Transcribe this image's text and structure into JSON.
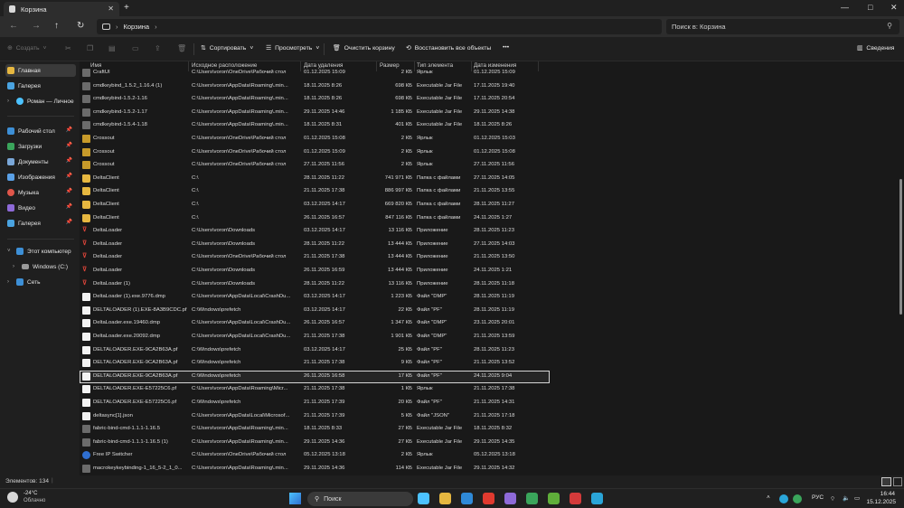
{
  "window": {
    "tab_title": "Корзина",
    "minimize": "—",
    "maximize": "□",
    "close": "✕",
    "tab_close": "✕",
    "new_tab": "+"
  },
  "address": {
    "path": "Корзина",
    "search_placeholder": "Поиск в: Корзина"
  },
  "toolbar": {
    "create": "Создать",
    "sort": "Сортировать",
    "view": "Просмотреть",
    "empty_bin": "Очистить корзину",
    "restore_all": "Восстановить все объекты",
    "more": "•••",
    "details": "Сведения"
  },
  "sidebar": {
    "home": "Главная",
    "gallery_top": "Галерея",
    "onedrive": "Роман — Личное",
    "desktop": "Рабочий стол",
    "downloads": "Загрузки",
    "documents": "Документы",
    "images": "Изображения",
    "music": "Музыка",
    "videos": "Видео",
    "gallery": "Галерея",
    "this_pc": "Этот компьютер",
    "windows_c": "Windows (C:)",
    "network": "Сеть"
  },
  "columns": {
    "name": "Имя",
    "origin": "Исходное расположение",
    "deleted": "Дата удаления",
    "size": "Размер",
    "type": "Тип элемента",
    "modified": "Дата изменения"
  },
  "files": [
    {
      "icon": "jar",
      "name": "CraftUI",
      "origin": "C:\\Users\\voron\\OneDrive\\Рабочий стол",
      "deleted": "01.12.2025 15:09",
      "size": "2 КБ",
      "type": "Ярлык",
      "modified": "01.12.2025 15:09"
    },
    {
      "icon": "jar",
      "name": "cmdkeybind_1.5.2_1.16.4 (1)",
      "origin": "C:\\Users\\voron\\AppData\\Roaming\\.min...",
      "deleted": "18.11.2025 8:26",
      "size": "698 КБ",
      "type": "Executable Jar File",
      "modified": "17.11.2025 19:40"
    },
    {
      "icon": "jar",
      "name": "cmdkeybind-1.5.2-1.16",
      "origin": "C:\\Users\\voron\\AppData\\Roaming\\.min...",
      "deleted": "18.11.2025 8:26",
      "size": "698 КБ",
      "type": "Executable Jar File",
      "modified": "17.11.2025 20:54"
    },
    {
      "icon": "jar",
      "name": "cmdkeybind-1.5.2-1.17",
      "origin": "C:\\Users\\voron\\AppData\\Roaming\\.min...",
      "deleted": "29.11.2025 14:46",
      "size": "1 185 КБ",
      "type": "Executable Jar File",
      "modified": "29.11.2025 14:38"
    },
    {
      "icon": "jar",
      "name": "cmdkeybind-1.5.4-1.18",
      "origin": "C:\\Users\\voron\\AppData\\Roaming\\.min...",
      "deleted": "18.11.2025 8:31",
      "size": "401 КБ",
      "type": "Executable Jar File",
      "modified": "18.11.2025 8:26"
    },
    {
      "icon": "xo",
      "name": "Crossout",
      "origin": "C:\\Users\\voron\\OneDrive\\Рабочий стол",
      "deleted": "01.12.2025 15:08",
      "size": "2 КБ",
      "type": "Ярлык",
      "modified": "01.12.2025 15:03"
    },
    {
      "icon": "xo",
      "name": "Crossout",
      "origin": "C:\\Users\\voron\\OneDrive\\Рабочий стол",
      "deleted": "01.12.2025 15:09",
      "size": "2 КБ",
      "type": "Ярлык",
      "modified": "01.12.2025 15:08"
    },
    {
      "icon": "xo",
      "name": "Crossout",
      "origin": "C:\\Users\\voron\\OneDrive\\Рабочий стол",
      "deleted": "27.11.2025 11:56",
      "size": "2 КБ",
      "type": "Ярлык",
      "modified": "27.11.2025 11:56"
    },
    {
      "icon": "folder",
      "name": "DeltaClient",
      "origin": "C:\\",
      "deleted": "28.11.2025 11:22",
      "size": "741 971 КБ",
      "type": "Папка с файлами",
      "modified": "27.11.2025 14:05"
    },
    {
      "icon": "folder",
      "name": "DeltaClient",
      "origin": "C:\\",
      "deleted": "21.11.2025 17:38",
      "size": "886 997 КБ",
      "type": "Папка с файлами",
      "modified": "21.11.2025 13:55"
    },
    {
      "icon": "folder",
      "name": "DeltaClient",
      "origin": "C:\\",
      "deleted": "03.12.2025 14:17",
      "size": "669 820 КБ",
      "type": "Папка с файлами",
      "modified": "28.11.2025 11:27"
    },
    {
      "icon": "folder",
      "name": "DeltaClient",
      "origin": "C:\\",
      "deleted": "26.11.2025 16:57",
      "size": "847 116 КБ",
      "type": "Папка с файлами",
      "modified": "24.11.2025 1:27"
    },
    {
      "icon": "app",
      "name": "DeltaLoader",
      "origin": "C:\\Users\\voron\\Downloads",
      "deleted": "03.12.2025 14:17",
      "size": "13 116 КБ",
      "type": "Приложение",
      "modified": "28.11.2025 11:23"
    },
    {
      "icon": "app",
      "name": "DeltaLoader",
      "origin": "C:\\Users\\voron\\Downloads",
      "deleted": "28.11.2025 11:22",
      "size": "13 444 КБ",
      "type": "Приложение",
      "modified": "27.11.2025 14:03"
    },
    {
      "icon": "app",
      "name": "DeltaLoader",
      "origin": "C:\\Users\\voron\\OneDrive\\Рабочий стол",
      "deleted": "21.11.2025 17:38",
      "size": "13 444 КБ",
      "type": "Приложение",
      "modified": "21.11.2025 13:50"
    },
    {
      "icon": "app",
      "name": "DeltaLoader",
      "origin": "C:\\Users\\voron\\Downloads",
      "deleted": "26.11.2025 16:59",
      "size": "13 444 КБ",
      "type": "Приложение",
      "modified": "24.11.2025 1:21"
    },
    {
      "icon": "app",
      "name": "DeltaLoader (1)",
      "origin": "C:\\Users\\voron\\Downloads",
      "deleted": "28.11.2025 11:22",
      "size": "13 116 КБ",
      "type": "Приложение",
      "modified": "28.11.2025 11:18"
    },
    {
      "icon": "doc",
      "name": "DeltaLoader (1).exe.9776.dmp",
      "origin": "C:\\Users\\voron\\AppData\\Local\\CrashDu...",
      "deleted": "03.12.2025 14:17",
      "size": "1 223 КБ",
      "type": "Файл \"DMP\"",
      "modified": "28.11.2025 11:19"
    },
    {
      "icon": "doc",
      "name": "DELTALOADER (1).EXE-8A3B9CDC.pf",
      "origin": "C:\\Windows\\prefetch",
      "deleted": "03.12.2025 14:17",
      "size": "22 КБ",
      "type": "Файл \"PF\"",
      "modified": "28.11.2025 11:19"
    },
    {
      "icon": "doc",
      "name": "DeltaLoader.exe.19460.dmp",
      "origin": "C:\\Users\\voron\\AppData\\Local\\CrashDu...",
      "deleted": "26.11.2025 16:57",
      "size": "1 347 КБ",
      "type": "Файл \"DMP\"",
      "modified": "23.11.2025 20:01"
    },
    {
      "icon": "doc",
      "name": "DeltaLoader.exe.20092.dmp",
      "origin": "C:\\Users\\voron\\AppData\\Local\\CrashDu...",
      "deleted": "21.11.2025 17:38",
      "size": "1 901 КБ",
      "type": "Файл \"DMP\"",
      "modified": "21.11.2025 13:59"
    },
    {
      "icon": "doc",
      "name": "DELTALOADER.EXE-9CA2B63A.pf",
      "origin": "C:\\Windows\\prefetch",
      "deleted": "03.12.2025 14:17",
      "size": "25 КБ",
      "type": "Файл \"PF\"",
      "modified": "28.11.2025 11:23"
    },
    {
      "icon": "doc",
      "name": "DELTALOADER.EXE-9CA2B63A.pf",
      "origin": "C:\\Windows\\prefetch",
      "deleted": "21.11.2025 17:38",
      "size": "9 КБ",
      "type": "Файл \"PF\"",
      "modified": "21.11.2025 13:52"
    },
    {
      "icon": "doc",
      "name": "DELTALOADER.EXE-9CA2B63A.pf",
      "origin": "C:\\Windows\\prefetch",
      "deleted": "26.11.2025 16:58",
      "size": "17 КБ",
      "type": "Файл \"PF\"",
      "modified": "24.11.2025 9:04",
      "selected": true
    },
    {
      "icon": "doc",
      "name": "DELTALOADER.EXE-E57225C6.pf",
      "origin": "C:\\Users\\voron\\AppData\\Roaming\\Micr...",
      "deleted": "21.11.2025 17:38",
      "size": "1 КБ",
      "type": "Ярлык",
      "modified": "21.11.2025 17:38"
    },
    {
      "icon": "doc",
      "name": "DELTALOADER.EXE-E57225C6.pf",
      "origin": "C:\\Windows\\prefetch",
      "deleted": "21.11.2025 17:39",
      "size": "20 КБ",
      "type": "Файл \"PF\"",
      "modified": "21.11.2025 14:31"
    },
    {
      "icon": "doc",
      "name": "deltasync[1].json",
      "origin": "C:\\Users\\voron\\AppData\\Local\\Microsof...",
      "deleted": "21.11.2025 17:39",
      "size": "5 КБ",
      "type": "Файл \"JSON\"",
      "modified": "21.11.2025 17:18"
    },
    {
      "icon": "jar",
      "name": "fabric-bind-cmd-1.1.1-1.16.5",
      "origin": "C:\\Users\\voron\\AppData\\Roaming\\.min...",
      "deleted": "18.11.2025 8:33",
      "size": "27 КБ",
      "type": "Executable Jar File",
      "modified": "18.11.2025 8:32"
    },
    {
      "icon": "jar",
      "name": "fabric-bind-cmd-1.1.1-1.16.5 (1)",
      "origin": "C:\\Users\\voron\\AppData\\Roaming\\.min...",
      "deleted": "29.11.2025 14:36",
      "size": "27 КБ",
      "type": "Executable Jar File",
      "modified": "29.11.2025 14:35"
    },
    {
      "icon": "fip",
      "name": "Free IP Switcher",
      "origin": "C:\\Users\\voron\\OneDrive\\Рабочий стол",
      "deleted": "05.12.2025 13:18",
      "size": "2 КБ",
      "type": "Ярлык",
      "modified": "05.12.2025 13:18"
    },
    {
      "icon": "jar",
      "name": "macrokeykeybinding-1_16_5-2_1_0...",
      "origin": "C:\\Users\\voron\\AppData\\Roaming\\.min...",
      "deleted": "29.11.2025 14:36",
      "size": "114 КБ",
      "type": "Executable Jar File",
      "modified": "29.11.2025 14:32"
    }
  ],
  "status": {
    "count": "Элементов: 134"
  },
  "taskbar": {
    "weather_temp": "-24°C",
    "weather_desc": "Облачно",
    "search": "Поиск",
    "lang": "РУС",
    "time": "16:44",
    "date": "15.12.2025",
    "colors": [
      "#4cc2ff",
      "#e6b740",
      "#2f8ad8",
      "#e03a2f",
      "#8e6ad8",
      "#3aa55b",
      "#5fae3a",
      "#d33a3a",
      "#2aa5d8"
    ]
  }
}
